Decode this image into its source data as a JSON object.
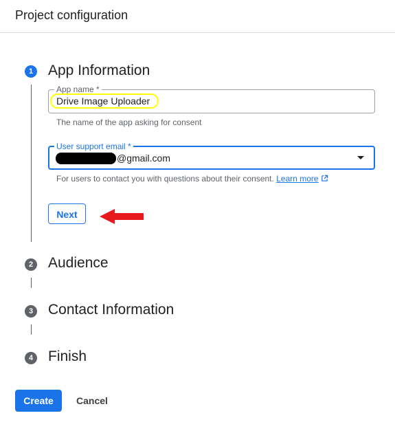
{
  "header": {
    "title": "Project configuration"
  },
  "steps": [
    {
      "number": "1",
      "title": "App Information"
    },
    {
      "number": "2",
      "title": "Audience"
    },
    {
      "number": "3",
      "title": "Contact Information"
    },
    {
      "number": "4",
      "title": "Finish"
    }
  ],
  "app_info": {
    "app_name": {
      "label": "App name *",
      "value": "Drive Image Uploader",
      "helper": "The name of the app asking for consent"
    },
    "support_email": {
      "label": "User support email *",
      "value": "@gmail.com",
      "helper": "For users to contact you with questions about their consent.",
      "learn_more": "Learn more"
    },
    "next_label": "Next"
  },
  "footer": {
    "create_label": "Create",
    "cancel_label": "Cancel"
  },
  "colors": {
    "accent": "#1a73e8",
    "highlight_annotation": "#ffff00",
    "arrow_annotation": "#e8191d",
    "redaction": "#000000"
  }
}
